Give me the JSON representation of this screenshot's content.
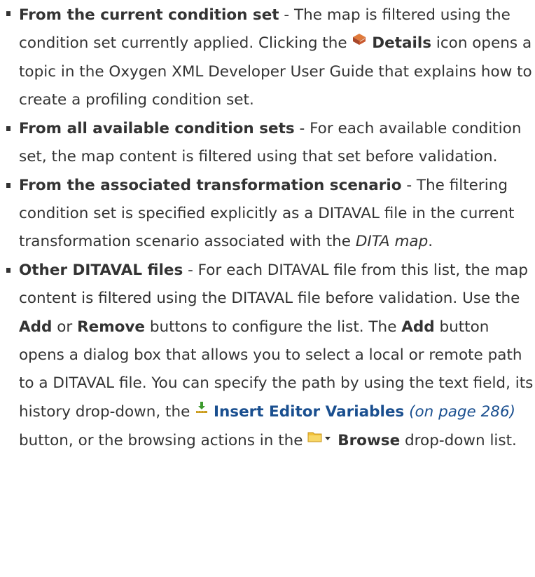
{
  "items": [
    {
      "title": "From the current condition set",
      "t1": " - The map is filtered using the condition set currently applied. Clicking the ",
      "details_label": "Details",
      "t2": " icon opens a topic in the Oxygen XML Developer User Guide that explains how to create a profiling condition set."
    },
    {
      "title": "From all available condition sets",
      "t1": " - For each available condition set, the map content is filtered using that set before validation."
    },
    {
      "title": "From the associated transformation scenario",
      "t1": " - The filtering condition set is specified explicitly as a DITAVAL file in the current transformation scenario associated with the ",
      "italic": "DITA map",
      "t2": "."
    },
    {
      "title": "Other DITAVAL files",
      "t1": " - For each DITAVAL file from this list, the map content is filtered using the DITAVAL file before validation. Use the ",
      "add": "Add",
      "t2": " or ",
      "remove": "Remove",
      "t3": " buttons to configure the list. The ",
      "add2": "Add",
      "t4": " button opens a dialog box that allows you to select a local or remote path to a DITAVAL file. You can specify the path by using the text field, its history drop-down, the ",
      "insert_link": "Insert Editor Variables",
      "page_ref": "(on page 286)",
      "t5": " button, or the browsing actions in the ",
      "browse": "Browse",
      "t6": " drop-down list."
    }
  ],
  "icons": [
    "book-icon",
    "insert-variables-icon",
    "folder-icon",
    "dropdown-arrow-icon"
  ]
}
